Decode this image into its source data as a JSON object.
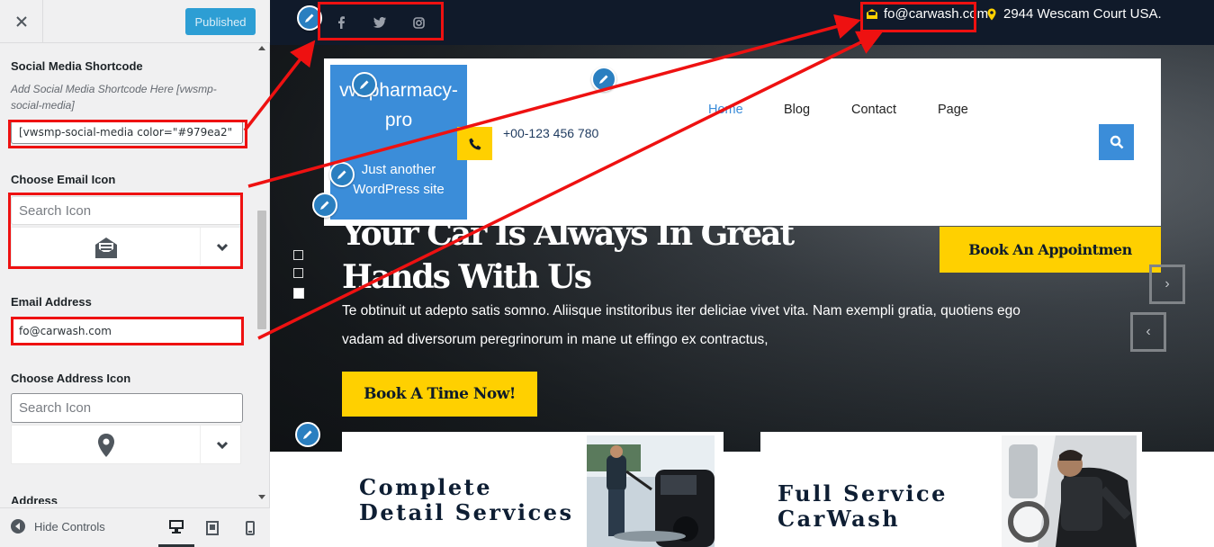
{
  "sidebar": {
    "close_icon": "close-icon",
    "publish_label": "Published",
    "social_section": {
      "label": "Social Media Shortcode",
      "description": "Add Social Media Shortcode Here [vwsmp-social-media]",
      "value": "[vwsmp-social-media color=\"#979ea2\""
    },
    "email_icon_section": {
      "label": "Choose Email Icon",
      "search_placeholder": "Search Icon",
      "icon": "envelope-open-icon"
    },
    "email_address_section": {
      "label": "Email Address",
      "value": "fo@carwash.com"
    },
    "address_icon_section": {
      "label": "Choose Address Icon",
      "search_placeholder": "Search Icon",
      "icon": "map-marker-icon"
    },
    "address_section": {
      "label": "Address"
    },
    "footer": {
      "hide_controls_label": "Hide Controls",
      "devices": [
        "desktop",
        "tablet",
        "mobile"
      ]
    }
  },
  "preview": {
    "topbar": {
      "social_icons": [
        "facebook-icon",
        "twitter-icon",
        "instagram-icon"
      ],
      "email": "fo@carwash.com",
      "address": "2944 Wescam Court USA."
    },
    "header": {
      "site_title": "vw-pharmacy-pro",
      "tagline": "Just another WordPress site",
      "phone": "+00-123 456 780",
      "nav": [
        "Home",
        "Blog",
        "Contact",
        "Page"
      ],
      "active_nav": "Home"
    },
    "hero": {
      "title": "Your Car Is Always In Great Hands With Us",
      "text": "Te obtinuit ut adepto satis somno. Aliisque institoribus iter deliciae vivet vita. Nam exempli gratia, quotiens ego vadam ad diversorum peregrinorum in mane ut effingo ex contractus,",
      "cta": "Book A Time Now!",
      "appointment": "Book An Appointmen",
      "next": "›",
      "prev": "‹"
    },
    "services": [
      {
        "title": "Complete Detail Services"
      },
      {
        "title": "Full Service CarWash"
      }
    ]
  },
  "colors": {
    "accent_blue": "#3b8dd9",
    "accent_yellow": "#ffd000",
    "topbar_dark": "#101a2a",
    "annotation_red": "#ee1111"
  }
}
